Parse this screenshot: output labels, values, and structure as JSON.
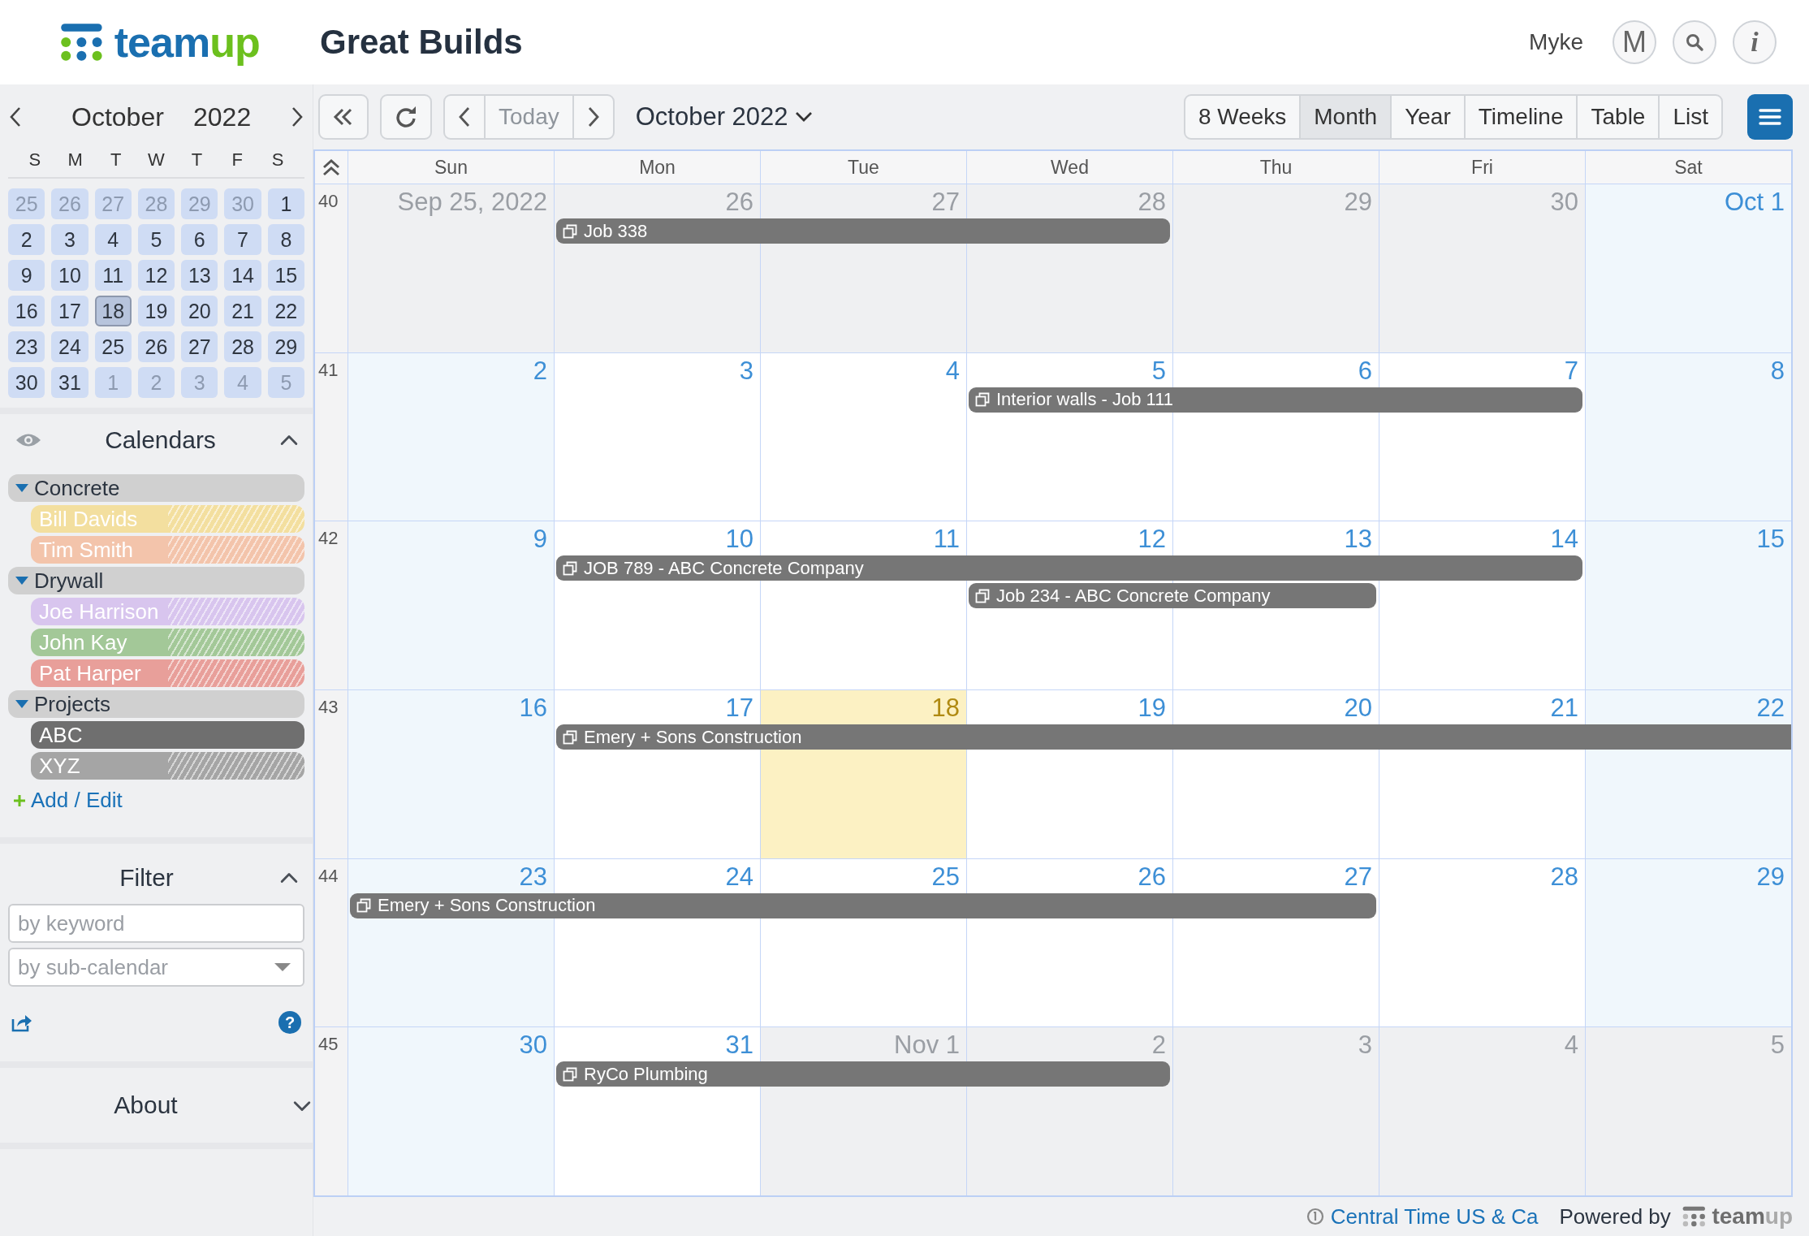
{
  "header": {
    "logo_text": [
      "team",
      "up"
    ],
    "title": "Great Builds",
    "user_name": "Myke",
    "avatar_letter": "M",
    "info_button": "i"
  },
  "mini_calendar": {
    "month": "October",
    "year": "2022",
    "weekdays": [
      "S",
      "M",
      "T",
      "W",
      "T",
      "F",
      "S"
    ],
    "days": [
      {
        "label": "25",
        "outside": true,
        "selected": false
      },
      {
        "label": "26",
        "outside": true,
        "selected": false
      },
      {
        "label": "27",
        "outside": true,
        "selected": false
      },
      {
        "label": "28",
        "outside": true,
        "selected": false
      },
      {
        "label": "29",
        "outside": true,
        "selected": false
      },
      {
        "label": "30",
        "outside": true,
        "selected": false
      },
      {
        "label": "1",
        "outside": false,
        "selected": false
      },
      {
        "label": "2",
        "outside": false,
        "selected": false
      },
      {
        "label": "3",
        "outside": false,
        "selected": false
      },
      {
        "label": "4",
        "outside": false,
        "selected": false
      },
      {
        "label": "5",
        "outside": false,
        "selected": false
      },
      {
        "label": "6",
        "outside": false,
        "selected": false
      },
      {
        "label": "7",
        "outside": false,
        "selected": false
      },
      {
        "label": "8",
        "outside": false,
        "selected": false
      },
      {
        "label": "9",
        "outside": false,
        "selected": false
      },
      {
        "label": "10",
        "outside": false,
        "selected": false
      },
      {
        "label": "11",
        "outside": false,
        "selected": false
      },
      {
        "label": "12",
        "outside": false,
        "selected": false
      },
      {
        "label": "13",
        "outside": false,
        "selected": false
      },
      {
        "label": "14",
        "outside": false,
        "selected": false
      },
      {
        "label": "15",
        "outside": false,
        "selected": false
      },
      {
        "label": "16",
        "outside": false,
        "selected": false
      },
      {
        "label": "17",
        "outside": false,
        "selected": false
      },
      {
        "label": "18",
        "outside": false,
        "selected": true
      },
      {
        "label": "19",
        "outside": false,
        "selected": false
      },
      {
        "label": "20",
        "outside": false,
        "selected": false
      },
      {
        "label": "21",
        "outside": false,
        "selected": false
      },
      {
        "label": "22",
        "outside": false,
        "selected": false
      },
      {
        "label": "23",
        "outside": false,
        "selected": false
      },
      {
        "label": "24",
        "outside": false,
        "selected": false
      },
      {
        "label": "25",
        "outside": false,
        "selected": false
      },
      {
        "label": "26",
        "outside": false,
        "selected": false
      },
      {
        "label": "27",
        "outside": false,
        "selected": false
      },
      {
        "label": "28",
        "outside": false,
        "selected": false
      },
      {
        "label": "29",
        "outside": false,
        "selected": false
      },
      {
        "label": "30",
        "outside": false,
        "selected": false
      },
      {
        "label": "31",
        "outside": false,
        "selected": false
      },
      {
        "label": "1",
        "outside": true,
        "selected": false
      },
      {
        "label": "2",
        "outside": true,
        "selected": false
      },
      {
        "label": "3",
        "outside": true,
        "selected": false
      },
      {
        "label": "4",
        "outside": true,
        "selected": false
      },
      {
        "label": "5",
        "outside": true,
        "selected": false
      }
    ]
  },
  "calendars": {
    "title": "Calendars",
    "expanded": true,
    "groups": [
      {
        "name": "Concrete",
        "expanded": true,
        "children": [
          {
            "name": "Bill Davids",
            "color": "#f3df9f",
            "active": false
          },
          {
            "name": "Tim Smith",
            "color": "#f3c4ab",
            "active": false
          }
        ]
      },
      {
        "name": "Drywall",
        "expanded": true,
        "children": [
          {
            "name": "Joe Harrison",
            "color": "#d8c5ee",
            "active": false
          },
          {
            "name": "John Kay",
            "color": "#a3c898",
            "active": false
          },
          {
            "name": "Pat Harper",
            "color": "#e89f9a",
            "active": false
          }
        ]
      },
      {
        "name": "Projects",
        "expanded": true,
        "children": [
          {
            "name": "ABC",
            "color": "#6f6f6f",
            "active": true
          },
          {
            "name": "XYZ",
            "color": "#a5a5a5",
            "active": false
          }
        ]
      }
    ],
    "add_edit": "Add / Edit"
  },
  "filter": {
    "title": "Filter",
    "expanded": true,
    "keyword_placeholder": "by keyword",
    "subcalendar_placeholder": "by sub-calendar",
    "help_button": "?"
  },
  "about": {
    "title": "About",
    "expanded": false
  },
  "toolbar": {
    "today": "Today",
    "period": "October 2022",
    "views": [
      {
        "label": "8 Weeks",
        "selected": false
      },
      {
        "label": "Month",
        "selected": true
      },
      {
        "label": "Year",
        "selected": false
      },
      {
        "label": "Timeline",
        "selected": false
      },
      {
        "label": "Table",
        "selected": false
      },
      {
        "label": "List",
        "selected": false
      }
    ]
  },
  "month": {
    "weekdays": [
      "Sun",
      "Mon",
      "Tue",
      "Wed",
      "Thu",
      "Fri",
      "Sat"
    ],
    "weeks": [
      {
        "number": "40",
        "days": [
          {
            "label": "Sep 25, 2022",
            "kind": "outside"
          },
          {
            "label": "26",
            "kind": "outside"
          },
          {
            "label": "27",
            "kind": "outside"
          },
          {
            "label": "28",
            "kind": "outside"
          },
          {
            "label": "29",
            "kind": "outside"
          },
          {
            "label": "30",
            "kind": "outside"
          },
          {
            "label": "Oct 1",
            "kind": "weekend"
          }
        ],
        "events": [
          {
            "title": "Job 338"
          }
        ]
      },
      {
        "number": "41",
        "days": [
          {
            "label": "2",
            "kind": "weekend"
          },
          {
            "label": "3",
            "kind": "weekday"
          },
          {
            "label": "4",
            "kind": "weekday"
          },
          {
            "label": "5",
            "kind": "weekday"
          },
          {
            "label": "6",
            "kind": "weekday"
          },
          {
            "label": "7",
            "kind": "weekday"
          },
          {
            "label": "8",
            "kind": "weekend"
          }
        ],
        "events": [
          {
            "title": "Interior walls - Job 111"
          }
        ]
      },
      {
        "number": "42",
        "days": [
          {
            "label": "9",
            "kind": "weekend"
          },
          {
            "label": "10",
            "kind": "weekday"
          },
          {
            "label": "11",
            "kind": "weekday"
          },
          {
            "label": "12",
            "kind": "weekday"
          },
          {
            "label": "13",
            "kind": "weekday"
          },
          {
            "label": "14",
            "kind": "weekday"
          },
          {
            "label": "15",
            "kind": "weekend"
          }
        ],
        "events": [
          {
            "title": "JOB 789 - ABC Concrete Company"
          },
          {
            "title": "Job 234 - ABC Concrete Company"
          }
        ]
      },
      {
        "number": "43",
        "days": [
          {
            "label": "16",
            "kind": "weekend"
          },
          {
            "label": "17",
            "kind": "weekday"
          },
          {
            "label": "18",
            "kind": "today"
          },
          {
            "label": "19",
            "kind": "weekday"
          },
          {
            "label": "20",
            "kind": "weekday"
          },
          {
            "label": "21",
            "kind": "weekday"
          },
          {
            "label": "22",
            "kind": "weekend"
          }
        ],
        "events": [
          {
            "title": "Emery + Sons Construction"
          }
        ]
      },
      {
        "number": "44",
        "days": [
          {
            "label": "23",
            "kind": "weekend"
          },
          {
            "label": "24",
            "kind": "weekday"
          },
          {
            "label": "25",
            "kind": "weekday"
          },
          {
            "label": "26",
            "kind": "weekday"
          },
          {
            "label": "27",
            "kind": "weekday"
          },
          {
            "label": "28",
            "kind": "weekday"
          },
          {
            "label": "29",
            "kind": "weekend"
          }
        ],
        "events": [
          {
            "title": "Emery + Sons Construction"
          }
        ]
      },
      {
        "number": "45",
        "days": [
          {
            "label": "30",
            "kind": "weekend"
          },
          {
            "label": "31",
            "kind": "weekday"
          },
          {
            "label": "Nov 1",
            "kind": "outside"
          },
          {
            "label": "2",
            "kind": "outside"
          },
          {
            "label": "3",
            "kind": "outside"
          },
          {
            "label": "4",
            "kind": "outside"
          },
          {
            "label": "5",
            "kind": "outside"
          }
        ],
        "events": [
          {
            "title": "RyCo Plumbing"
          }
        ]
      }
    ]
  },
  "footer": {
    "timezone": "Central Time US & Ca",
    "powered_by": "Powered by",
    "logo_text": [
      "team",
      "up"
    ]
  }
}
